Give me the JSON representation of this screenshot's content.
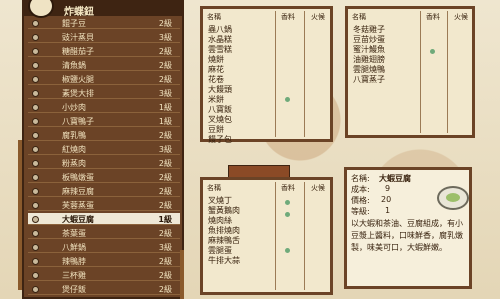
{
  "left_panel": {
    "title": "炸蝶鈕",
    "items": [
      {
        "name": "餛子豆",
        "level": "2級"
      },
      {
        "name": "豉汁蒸貝",
        "level": "3級"
      },
      {
        "name": "糖醋茄子",
        "level": "2級"
      },
      {
        "name": "清魚鍋",
        "level": "2級"
      },
      {
        "name": "椒鹽火腿",
        "level": "2級"
      },
      {
        "name": "素煲大排",
        "level": "3級"
      },
      {
        "name": "小炒肉",
        "level": "1級"
      },
      {
        "name": "八寶鴨子",
        "level": "1級"
      },
      {
        "name": "腐乳鴨",
        "level": "2級"
      },
      {
        "name": "紅燒肉",
        "level": "3級"
      },
      {
        "name": "粉蒸肉",
        "level": "2級"
      },
      {
        "name": "板鴨燉蛋",
        "level": "2級"
      },
      {
        "name": "麻辣豆腐",
        "level": "2級"
      },
      {
        "name": "芙蓉蒸蛋",
        "level": "2級"
      },
      {
        "name": "大蝦豆腐",
        "level": "1級"
      },
      {
        "name": "茶葉蛋",
        "level": "2級"
      },
      {
        "name": "八鮮鍋",
        "level": "3級"
      },
      {
        "name": "辣鴨脖",
        "level": "2級"
      },
      {
        "name": "三杯雞",
        "level": "2級"
      },
      {
        "name": "煲仔飯",
        "level": "2級"
      }
    ],
    "selected_index": 14
  },
  "card_headers": {
    "name": "名稱",
    "cost": "香料",
    "taste": "火候"
  },
  "card1": {
    "ingredients": [
      "蟲八鍋",
      "水晶糕",
      "雲雪糕",
      "燒餅",
      "麻花",
      "花卷",
      "大饅頭",
      "米餅",
      "八寶飯",
      "叉燒包",
      "豆餅",
      "饅子包"
    ]
  },
  "card2": {
    "ingredients": [
      "冬菇雞子",
      "豆苗炒蛋",
      "蜜汁鰻魚",
      "油雞翅膀",
      "雲腿燒鴨",
      "八寶蒸子"
    ]
  },
  "card3": {
    "ingredients": [
      "叉燒丁",
      "蟹黃鵝肉",
      "燒肉絲",
      "魚排燒肉",
      "麻辣鴨舌",
      "雲腿蛋",
      "牛排大蒜"
    ]
  },
  "info": {
    "name_label": "名稱:",
    "name": "大蝦豆腐",
    "cost_label": "成本:",
    "cost": "9",
    "price_label": "價格:",
    "price": "20",
    "level_label": "等級:",
    "level": "1",
    "description": "以大蝦和茶油、豆腐組成，有小豆漿上醬料，口味鮮香，腐乳燉製，味美可口，大蝦鮮嫩。"
  }
}
